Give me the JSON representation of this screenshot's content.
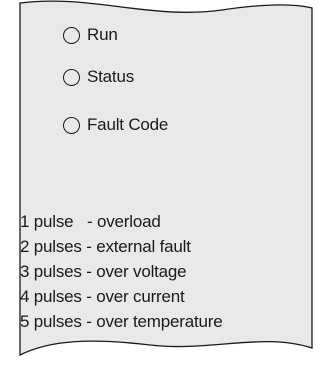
{
  "indicators": [
    {
      "label": "Run",
      "icon": "led-circle-icon"
    },
    {
      "label": "Status",
      "icon": "led-circle-icon"
    },
    {
      "label": "Fault Code",
      "icon": "led-circle-icon"
    }
  ],
  "fault_codes": [
    {
      "pulses": "1 pulse",
      "meaning": "overload",
      "text": "1 pulse   - overload"
    },
    {
      "pulses": "2 pulses",
      "meaning": "external fault",
      "text": "2 pulses - external fault"
    },
    {
      "pulses": "3 pulses",
      "meaning": "over voltage",
      "text": "3 pulses - over voltage"
    },
    {
      "pulses": "4 pulses",
      "meaning": "over current",
      "text": "4 pulses - over current"
    },
    {
      "pulses": "5 pulses",
      "meaning": "over temperature",
      "text": "5 pulses - over temperature"
    }
  ],
  "colors": {
    "panel_fill": "#e9e9e9",
    "outline": "#1a1a1a",
    "text": "#1a1a1a"
  }
}
